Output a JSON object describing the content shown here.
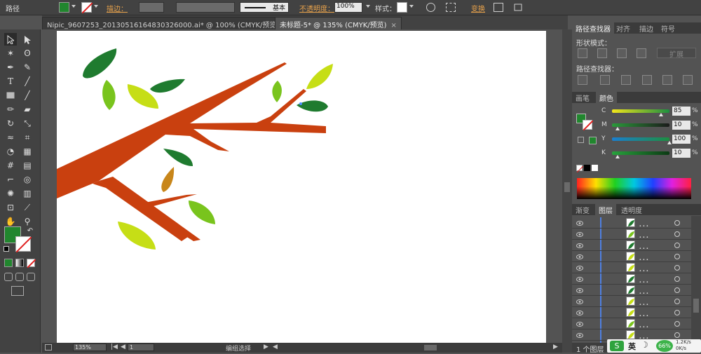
{
  "app": {
    "selection_label": "路径"
  },
  "control_bar": {
    "stroke_label": "描边：",
    "stroke_profile": "基本",
    "opacity_label": "不透明度：",
    "opacity_value": "100%",
    "style_label": "样式：",
    "transform_label": "变换",
    "fill_color": "#21862e"
  },
  "tabs": [
    {
      "label": "Nipic_9607253_20130516164830326000.ai* @ 100% (CMYK/预览)",
      "close": "×"
    },
    {
      "label": "未标题-5* @ 135% (CMYK/预览)",
      "close": "×"
    }
  ],
  "panel_pathfinder": {
    "tabs": [
      "路径查找器",
      "对齐",
      "描边",
      "符号"
    ],
    "shape_modes_label": "形状模式：",
    "expand_label": "扩展",
    "pathfinders_label": "路径查找器："
  },
  "panel_color": {
    "tabs": [
      "画笔",
      "颜色"
    ],
    "channels": [
      {
        "label": "C",
        "value": "85",
        "pct": "%",
        "position": 0.85
      },
      {
        "label": "M",
        "value": "10",
        "pct": "%",
        "position": 0.1
      },
      {
        "label": "Y",
        "value": "100",
        "pct": "%",
        "position": 1.0
      },
      {
        "label": "K",
        "value": "10",
        "pct": "%",
        "position": 0.1
      }
    ]
  },
  "panel_layers": {
    "tabs": [
      "渐变",
      "图层",
      "透明度"
    ],
    "row_dots": "．．．",
    "footer": "1 个图层"
  },
  "status": {
    "zoom": "135%",
    "page": "1",
    "tool": "编组选择"
  },
  "ime": {
    "lang": "英",
    "battery": "66%",
    "speed_up": "1.2K/s",
    "speed_down": "0K/s"
  },
  "colors": {
    "branch": "#c9400f",
    "dark_leaf": "#1f7b2f",
    "lime_leaf": "#c6de16",
    "green_leaf": "#79c41d",
    "orange_leaf": "#c8861a"
  }
}
